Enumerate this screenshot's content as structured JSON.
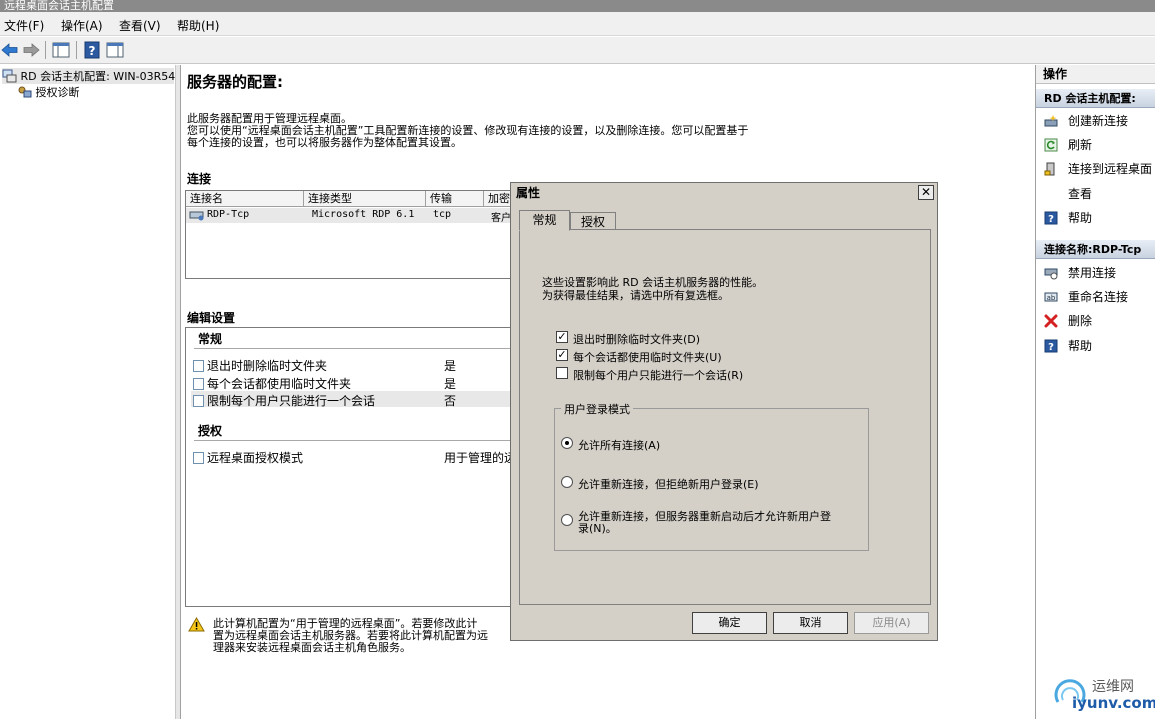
{
  "window": {
    "title": "远程桌面会话主机配置"
  },
  "menu": [
    "文件(F)",
    "操作(A)",
    "查看(V)",
    "帮助(H)"
  ],
  "tree": {
    "root": "RD 会话主机配置: WIN-03R54",
    "child": "授权诊断"
  },
  "main": {
    "heading": "服务器的配置:",
    "desc1": "此服务器配置用于管理远程桌面。",
    "desc2": "您可以使用“远程桌面会话主机配置”工具配置新连接的设置、修改现有连接的设置，以及删除连接。您可以配置基于",
    "desc3": "每个连接的设置，也可以将服务器作为整体配置其设置。",
    "connections_title": "连接",
    "columns": [
      "连接名",
      "连接类型",
      "传输",
      "加密"
    ],
    "row": {
      "name": "RDP-Tcp",
      "type": "Microsoft RDP 6.1",
      "transport": "tcp",
      "encryption": "客户"
    },
    "edit_title": "编辑设置",
    "general_title": "常规",
    "settings": [
      {
        "label": "退出时删除临时文件夹",
        "value": "是"
      },
      {
        "label": "每个会话都使用临时文件夹",
        "value": "是"
      },
      {
        "label": "限制每个用户只能进行一个会话",
        "value": "否"
      }
    ],
    "licensing_title": "授权",
    "licensing_label": "远程桌面授权模式",
    "licensing_value": "用于管理的远",
    "warning1": "此计算机配置为“用于管理的远程桌面”。若要修改此计",
    "warning2": "置为远程桌面会话主机服务器。若要将此计算机配置为远",
    "warning3": "理器来安装远程桌面会话主机角色服务。"
  },
  "actions": {
    "header": "操作",
    "group1": "RD 会话主机配置:",
    "items1": [
      "创建新连接",
      "刷新",
      "连接到远程桌面",
      "查看",
      "帮助"
    ],
    "group2": "连接名称:RDP-Tcp",
    "items2": [
      "禁用连接",
      "重命名连接",
      "删除",
      "帮助"
    ]
  },
  "dialog": {
    "title": "属性",
    "tabs": [
      "常规",
      "授权"
    ],
    "info1": "这些设置影响此 RD 会话主机服务器的性能。",
    "info2": "为获得最佳结果，请选中所有复选框。",
    "checks": [
      {
        "label": "退出时删除临时文件夹(D)",
        "checked": true
      },
      {
        "label": "每个会话都使用临时文件夹(U)",
        "checked": true
      },
      {
        "label": "限制每个用户只能进行一个会话(R)",
        "checked": false
      }
    ],
    "group_title": "用户登录模式",
    "radios": [
      "允许所有连接(A)",
      "允许重新连接，但拒绝新用户登录(E)",
      "允许重新连接，但服务器重新启动后才允许新用户登",
      "录(N)。"
    ],
    "buttons": {
      "ok": "确定",
      "cancel": "取消",
      "apply": "应用(A)"
    }
  },
  "watermark": {
    "name": "运维网",
    "url": "iyunv.com"
  },
  "colors": {
    "accent": "#1e5ba8",
    "dialog_bg": "#d4d0c8",
    "delete_red": "#d42020"
  }
}
